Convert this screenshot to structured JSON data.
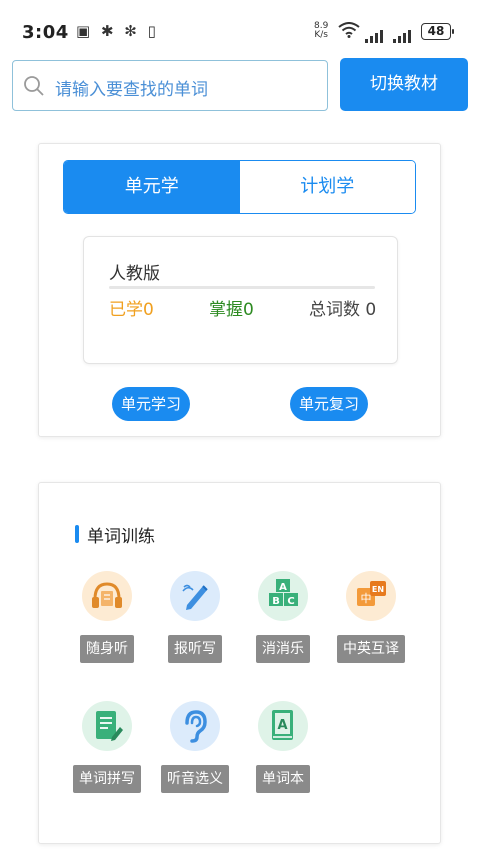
{
  "status_bar": {
    "time": "3:04",
    "speed_value": "8.9",
    "speed_unit": "K/s",
    "battery": "48"
  },
  "search": {
    "placeholder": "请输入要查找的单词"
  },
  "switch_textbook_label": "切换教材",
  "tabs": [
    {
      "label": "单元学"
    },
    {
      "label": "计划学"
    }
  ],
  "book": {
    "name": "人教版",
    "learned_label": "已学0",
    "mastered_label": "掌握0",
    "total_label": "总词数 0",
    "colors": {
      "learned": "#f0a020",
      "mastered": "#2e8b22"
    }
  },
  "actions": {
    "unit_study": "单元学习",
    "unit_review": "单元复习"
  },
  "training": {
    "title": "单词训练",
    "items": [
      {
        "label": "随身听",
        "icon": "headphones-icon"
      },
      {
        "label": "报听写",
        "icon": "pencil-icon"
      },
      {
        "label": "消消乐",
        "icon": "abc-blocks-icon"
      },
      {
        "label": "中英互译",
        "icon": "translate-icon"
      },
      {
        "label": "单词拼写",
        "icon": "document-pen-icon"
      },
      {
        "label": "听音选义",
        "icon": "ear-icon"
      },
      {
        "label": "单词本",
        "icon": "word-book-icon"
      }
    ],
    "icon_letters": {
      "a": "A",
      "b": "B",
      "c": "C",
      "zh": "中",
      "en": "EN",
      "book": "A"
    }
  },
  "accent_color": "#1a8bf0"
}
